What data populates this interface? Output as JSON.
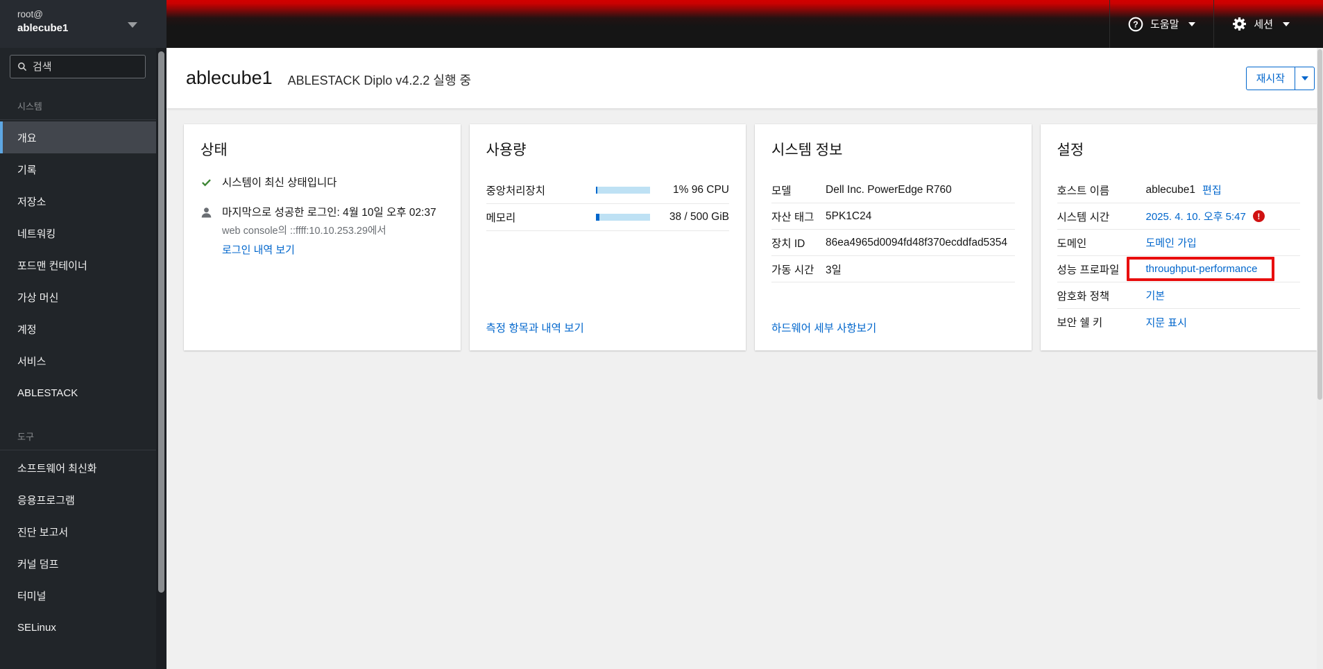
{
  "masthead": {
    "host_user": "root@",
    "host_name": "ablecube1",
    "help_label": "도움말",
    "session_label": "세션"
  },
  "sidebar": {
    "search_placeholder": "검색",
    "sections": [
      {
        "title": "시스템",
        "items": [
          {
            "label": "개요",
            "active": true
          },
          {
            "label": "기록"
          },
          {
            "label": "저장소"
          },
          {
            "label": "네트워킹"
          },
          {
            "label": "포드맨 컨테이너"
          },
          {
            "label": "가상 머신"
          },
          {
            "label": "계정"
          },
          {
            "label": "서비스"
          },
          {
            "label": "ABLESTACK"
          }
        ]
      },
      {
        "title": "도구",
        "items": [
          {
            "label": "소프트웨어 최신화"
          },
          {
            "label": "응용프로그램"
          },
          {
            "label": "진단 보고서"
          },
          {
            "label": "커널 덤프"
          },
          {
            "label": "터미널"
          },
          {
            "label": "SELinux"
          }
        ]
      }
    ]
  },
  "header": {
    "hostname": "ablecube1",
    "subtitle": "ABLESTACK Diplo v4.2.2 실행 중",
    "restart_label": "재시작"
  },
  "cards": {
    "status": {
      "title": "상태",
      "updates_ok": "시스템이 최신 상태입니다",
      "last_login": "마지막으로 성공한 로그인: 4월 10일 오후 02:37",
      "last_login_detail": "web console의 ::ffff:10.10.253.29에서",
      "login_history_link": "로그인 내역 보기"
    },
    "usage": {
      "title": "사용량",
      "cpu_label": "중앙처리장치",
      "cpu_value": "1% 96 CPU",
      "cpu_percent": 1,
      "memory_label": "메모리",
      "memory_value": "38 / 500 GiB",
      "memory_used_gib": 38,
      "memory_total_gib": 500,
      "metrics_link": "측정 항목과 내역 보기"
    },
    "system_info": {
      "title": "시스템 정보",
      "rows": [
        {
          "label": "모델",
          "value": "Dell Inc. PowerEdge R760"
        },
        {
          "label": "자산 태그",
          "value": "5PK1C24"
        },
        {
          "label": "장치 ID",
          "value": "86ea4965d0094fd48f370ecddfad5354"
        },
        {
          "label": "가동 시간",
          "value": "3일"
        }
      ],
      "hardware_link": "하드웨어 세부 사항보기"
    },
    "settings": {
      "title": "설정",
      "rows": [
        {
          "label": "호스트 이름",
          "value": "ablecube1",
          "action": "편집"
        },
        {
          "label": "시스템 시간",
          "value": "2025. 4. 10. 오후 5:47",
          "warning": true
        },
        {
          "label": "도메인",
          "value": "도메인 가입"
        },
        {
          "label": "성능 프로파일",
          "value": "throughput-performance",
          "highlighted": true
        },
        {
          "label": "암호화 정책",
          "value": "기본"
        },
        {
          "label": "보안 쉘 키",
          "value": "지문 표시"
        }
      ]
    }
  },
  "colors": {
    "link_blue": "#0066cc",
    "success_green": "#3e8635",
    "danger_red": "#d01212",
    "annotation_red": "#e80e0e",
    "progress_track": "#bee1f4",
    "progress_fill": "#0066cc"
  }
}
